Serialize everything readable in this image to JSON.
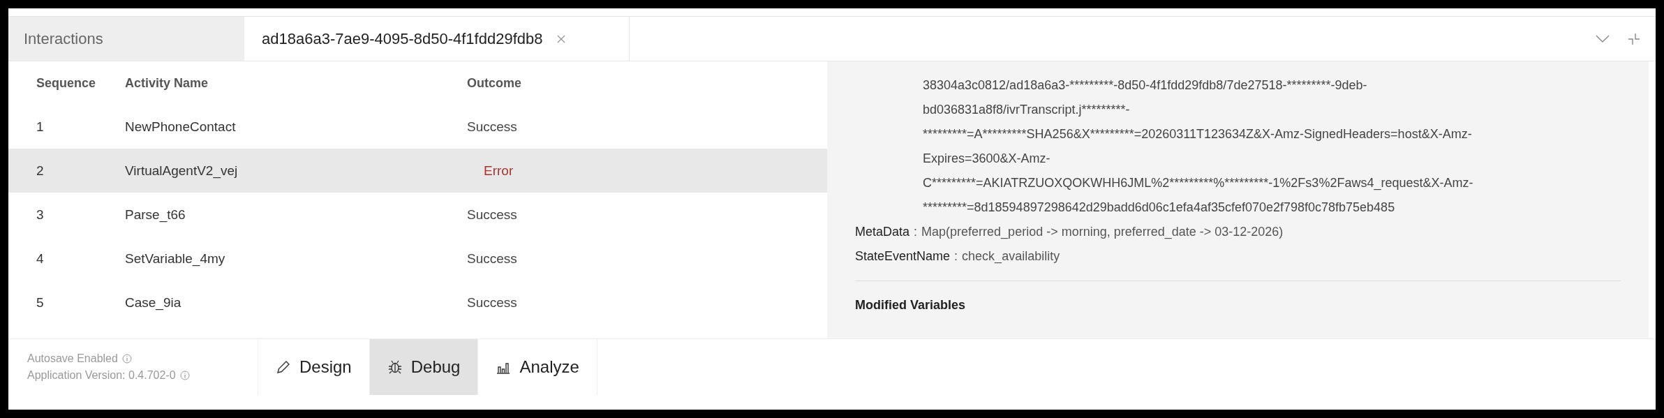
{
  "tabs": [
    {
      "label": "Interactions",
      "selected": false,
      "closable": false
    },
    {
      "label": "ad18a6a3-7ae9-4095-8d50-4f1fdd29fdb8",
      "selected": true,
      "closable": true
    }
  ],
  "table": {
    "columns": [
      "Sequence",
      "Activity Name",
      "Outcome"
    ],
    "rows": [
      {
        "sequence": "1",
        "activity": "NewPhoneContact",
        "outcome": "Success",
        "kind": "success",
        "selected": false
      },
      {
        "sequence": "2",
        "activity": "VirtualAgentV2_vej",
        "outcome": "Error",
        "kind": "error",
        "selected": true
      },
      {
        "sequence": "3",
        "activity": "Parse_t66",
        "outcome": "Success",
        "kind": "success",
        "selected": false
      },
      {
        "sequence": "4",
        "activity": "SetVariable_4my",
        "outcome": "Success",
        "kind": "success",
        "selected": false
      },
      {
        "sequence": "5",
        "activity": "Case_9ia",
        "outcome": "Success",
        "kind": "success",
        "selected": false
      }
    ]
  },
  "details": {
    "value_lines": [
      "38304a3c0812/ad18a6a3-*********-8d50-4f1fdd29fdb8/7de27518-*********-9deb-",
      "bd036831a8f8/ivrTranscript.j*********-",
      "*********=A*********SHA256&X*********=20260311T123634Z&X-Amz-SignedHeaders=host&X-Amz-",
      "Expires=3600&X-Amz-",
      "C*********=AKIATRZUOXQOKWHH6JML%2*********%*********-1%2Fs3%2Faws4_request&X-Amz-",
      "*********=8d18594897298642d29badd6d06c1efa4af35cfef070e2f798f0c78fb75eb485"
    ],
    "fields": [
      {
        "label": "MetaData",
        "separator": ":",
        "value": "Map(preferred_period -> morning, preferred_date -> 03-12-2026)"
      },
      {
        "label": "StateEventName",
        "separator": ":",
        "value": "check_availability"
      }
    ],
    "section_title": "Modified Variables"
  },
  "footer": {
    "info": [
      "Autosave Enabled",
      "Application Version: 0.4.702-0"
    ],
    "modes": [
      {
        "label": "Design",
        "kind": "design",
        "selected": false
      },
      {
        "label": "Debug",
        "kind": "debug",
        "selected": true
      },
      {
        "label": "Analyze",
        "kind": "analyze",
        "selected": false
      }
    ]
  }
}
